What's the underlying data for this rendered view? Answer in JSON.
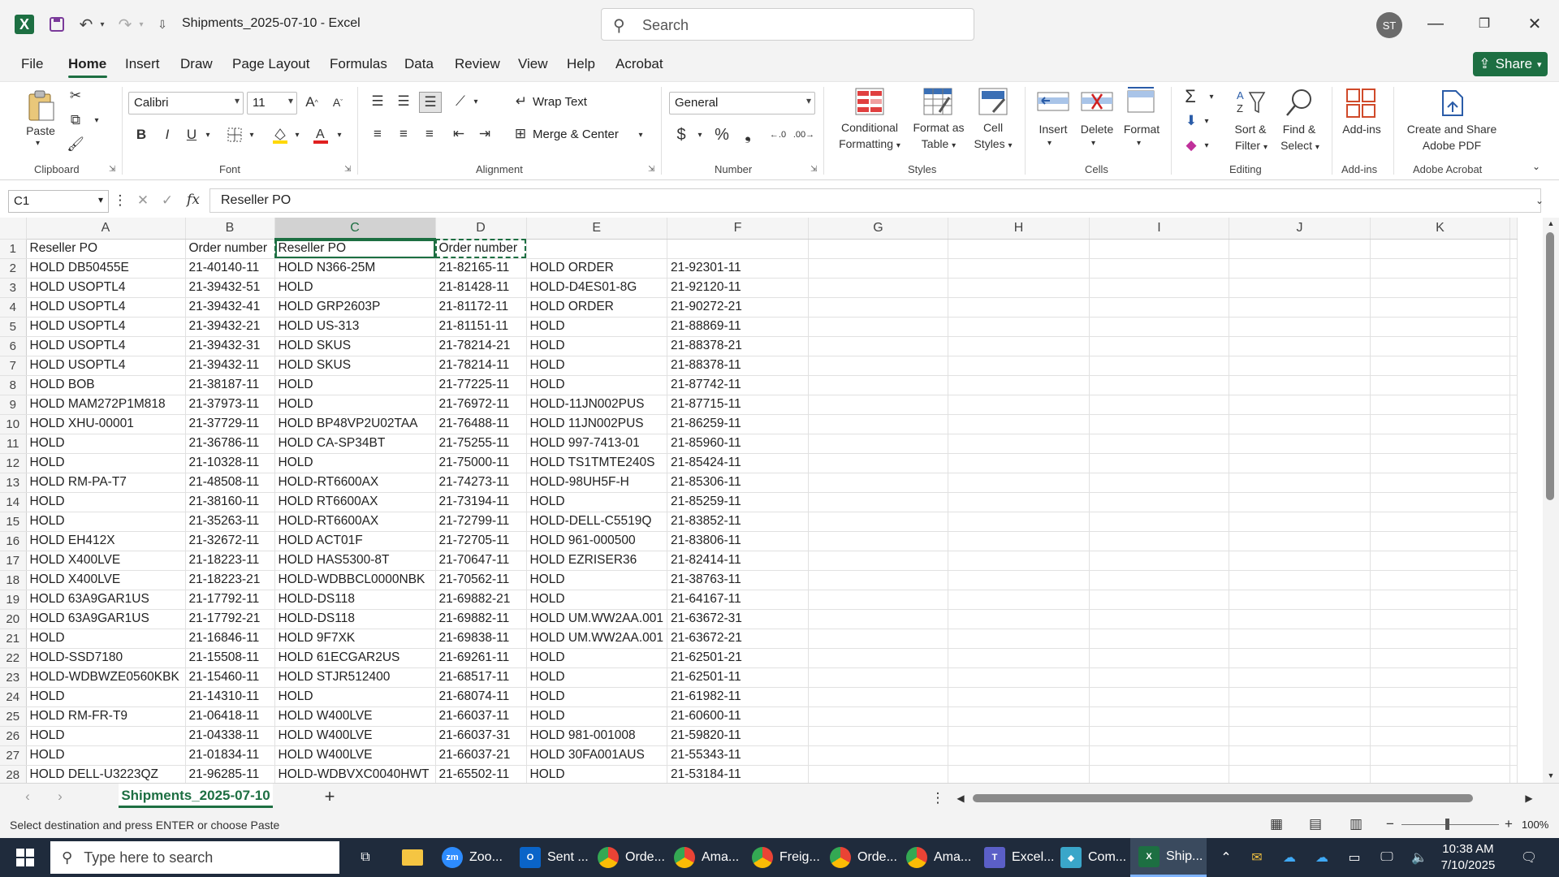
{
  "title_bar": {
    "document_title": "Shipments_2025-07-10  -  Excel",
    "search_placeholder": "Search",
    "avatar_initials": "ST"
  },
  "menu": {
    "items": [
      "File",
      "Home",
      "Insert",
      "Draw",
      "Page Layout",
      "Formulas",
      "Data",
      "Review",
      "View",
      "Help",
      "Acrobat"
    ],
    "active": "Home",
    "share_label": "Share"
  },
  "ribbon": {
    "clipboard": {
      "paste": "Paste",
      "group": "Clipboard"
    },
    "font": {
      "name": "Calibri",
      "size": "11",
      "group": "Font"
    },
    "alignment": {
      "wrap_text": "Wrap Text",
      "merge_center": "Merge & Center",
      "group": "Alignment"
    },
    "number": {
      "format": "General",
      "group": "Number"
    },
    "styles": {
      "conditional_1": "Conditional",
      "conditional_2": "Formatting",
      "format_table_1": "Format as",
      "format_table_2": "Table",
      "cell_styles_1": "Cell",
      "cell_styles_2": "Styles",
      "group": "Styles"
    },
    "cells": {
      "insert": "Insert",
      "delete": "Delete",
      "format": "Format",
      "group": "Cells"
    },
    "editing": {
      "sort_1": "Sort &",
      "sort_2": "Filter",
      "find_1": "Find &",
      "find_2": "Select",
      "group": "Editing"
    },
    "addins": {
      "label": "Add-ins",
      "group": "Add-ins"
    },
    "acrobat": {
      "label_1": "Create and Share",
      "label_2": "Adobe PDF",
      "group": "Adobe Acrobat"
    }
  },
  "formula_bar": {
    "name_box": "C1",
    "content": "Reseller PO"
  },
  "grid": {
    "columns": [
      "A",
      "B",
      "C",
      "D",
      "E",
      "F",
      "G",
      "H",
      "I",
      "J",
      "K"
    ],
    "rows": [
      [
        "Reseller PO",
        "Order number",
        "Reseller PO",
        "Order number",
        "",
        ""
      ],
      [
        "HOLD DB50455E",
        "21-40140-11",
        "HOLD N366-25M",
        "21-82165-11",
        "HOLD ORDER",
        "21-92301-11"
      ],
      [
        "HOLD USOPTL4",
        "21-39432-51",
        "HOLD",
        "21-81428-11",
        "HOLD-D4ES01-8G",
        "21-92120-11"
      ],
      [
        "HOLD USOPTL4",
        "21-39432-41",
        "HOLD GRP2603P",
        "21-81172-11",
        "HOLD ORDER",
        "21-90272-21"
      ],
      [
        "HOLD USOPTL4",
        "21-39432-21",
        "HOLD US-313",
        "21-81151-11",
        "HOLD",
        "21-88869-11"
      ],
      [
        "HOLD USOPTL4",
        "21-39432-31",
        "HOLD SKUS",
        "21-78214-21",
        "HOLD",
        "21-88378-21"
      ],
      [
        "HOLD USOPTL4",
        "21-39432-11",
        "HOLD SKUS",
        "21-78214-11",
        "HOLD",
        "21-88378-11"
      ],
      [
        "HOLD BOB",
        "21-38187-11",
        "HOLD",
        "21-77225-11",
        "HOLD",
        "21-87742-11"
      ],
      [
        "HOLD MAM272P1M818",
        "21-37973-11",
        "HOLD",
        "21-76972-11",
        "HOLD-11JN002PUS",
        "21-87715-11"
      ],
      [
        "HOLD XHU-00001",
        "21-37729-11",
        "HOLD BP48VP2U02TAA",
        "21-76488-11",
        "HOLD 11JN002PUS",
        "21-86259-11"
      ],
      [
        "HOLD",
        "21-36786-11",
        "HOLD CA-SP34BT",
        "21-75255-11",
        "HOLD 997-7413-01",
        "21-85960-11"
      ],
      [
        "HOLD",
        "21-10328-11",
        "HOLD",
        "21-75000-11",
        "HOLD TS1TMTE240S",
        "21-85424-11"
      ],
      [
        "HOLD RM-PA-T7",
        "21-48508-11",
        "HOLD-RT6600AX",
        "21-74273-11",
        "HOLD-98UH5F-H",
        "21-85306-11"
      ],
      [
        "HOLD",
        "21-38160-11",
        "HOLD RT6600AX",
        "21-73194-11",
        "HOLD",
        "21-85259-11"
      ],
      [
        "HOLD",
        "21-35263-11",
        "HOLD-RT6600AX",
        "21-72799-11",
        "HOLD-DELL-C5519Q",
        "21-83852-11"
      ],
      [
        "HOLD EH412X",
        "21-32672-11",
        "HOLD ACT01F",
        "21-72705-11",
        "HOLD 961-000500",
        "21-83806-11"
      ],
      [
        "HOLD X400LVE",
        "21-18223-11",
        "HOLD HAS5300-8T",
        "21-70647-11",
        "HOLD EZRISER36",
        "21-82414-11"
      ],
      [
        "HOLD X400LVE",
        "21-18223-21",
        "HOLD-WDBBCL0000NBK",
        "21-70562-11",
        "HOLD",
        "21-38763-11"
      ],
      [
        "HOLD 63A9GAR1US",
        "21-17792-11",
        "HOLD-DS118",
        "21-69882-21",
        "HOLD",
        "21-64167-11"
      ],
      [
        "HOLD 63A9GAR1US",
        "21-17792-21",
        "HOLD-DS118",
        "21-69882-11",
        "HOLD UM.WW2AA.001",
        "21-63672-31"
      ],
      [
        "HOLD",
        "21-16846-11",
        "HOLD 9F7XK",
        "21-69838-11",
        "HOLD UM.WW2AA.001",
        "21-63672-21"
      ],
      [
        "HOLD-SSD7180",
        "21-15508-11",
        "HOLD 61ECGAR2US",
        "21-69261-11",
        "HOLD",
        "21-62501-21"
      ],
      [
        "HOLD-WDBWZE0560KBK",
        "21-15460-11",
        "HOLD STJR512400",
        "21-68517-11",
        "HOLD",
        "21-62501-11"
      ],
      [
        "HOLD",
        "21-14310-11",
        "HOLD",
        "21-68074-11",
        "HOLD",
        "21-61982-11"
      ],
      [
        "HOLD RM-FR-T9",
        "21-06418-11",
        "HOLD W400LVE",
        "21-66037-11",
        "HOLD",
        "21-60600-11"
      ],
      [
        "HOLD",
        "21-04338-11",
        "HOLD W400LVE",
        "21-66037-31",
        "HOLD 981-001008",
        "21-59820-11"
      ],
      [
        "HOLD",
        "21-01834-11",
        "HOLD W400LVE",
        "21-66037-21",
        "HOLD 30FA001AUS",
        "21-55343-11"
      ],
      [
        "HOLD DELL-U3223QZ",
        "21-96285-11",
        "HOLD-WDBVXC0040HWT",
        "21-65502-11",
        "HOLD",
        "21-53184-11"
      ]
    ]
  },
  "sheet_tabs": {
    "active": "Shipments_2025-07-10",
    "add": "+"
  },
  "status": {
    "message": "Select destination and press ENTER or choose Paste",
    "zoom": "100%"
  },
  "taskbar": {
    "search": "Type here to search",
    "apps": [
      "Zoo...",
      "Sent ...",
      "Orde...",
      "Ama...",
      "Freig...",
      "Orde...",
      "Ama...",
      "Excel...",
      "Com...",
      "Ship..."
    ],
    "time": "10:38 AM",
    "date": "7/10/2025"
  },
  "colors": {
    "accent": "#1d6f42",
    "taskbar": "#1f2b3c"
  }
}
